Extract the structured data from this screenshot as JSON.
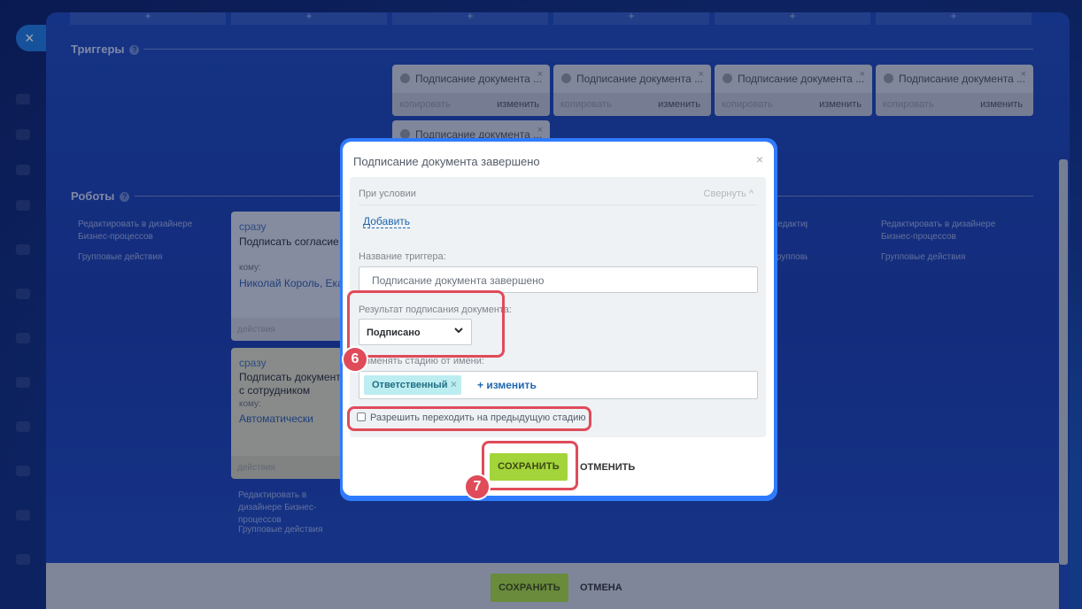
{
  "triggers_section": {
    "title": "Триггеры",
    "help": "?"
  },
  "robots_section": {
    "title": "Роботы",
    "help": "?"
  },
  "column_headers": [
    "+",
    "+",
    "+",
    "+",
    "+",
    "+"
  ],
  "trigger_cards": [
    {
      "name": "Подписание документа ...",
      "copy": "копировать",
      "edit": "изменить",
      "close": "×"
    },
    {
      "name": "Подписание документа ...",
      "copy": "копировать",
      "edit": "изменить",
      "close": "×"
    },
    {
      "name": "Подписание документа ...",
      "copy": "копировать",
      "edit": "изменить",
      "close": "×"
    },
    {
      "name": "Подписание документа ...",
      "copy": "копировать",
      "edit": "изменить",
      "close": "×"
    },
    {
      "name": "Подписание документа ...",
      "close": "×"
    }
  ],
  "side_links": {
    "edit_designer": "Редактировать в дизайнере Бизнес-процессов",
    "group_actions": "Групповые действия"
  },
  "robots": [
    {
      "when": "сразу",
      "title": "Подписать согласие на",
      "to_label": "кому:",
      "who": "Николай Король, Екат",
      "footer": "действия"
    },
    {
      "when": "сразу",
      "title": "Подписать документ с сотрудником",
      "to_label": "кому:",
      "who": "Автоматически",
      "footer": "действия"
    }
  ],
  "modal": {
    "title": "Подписание документа завершено",
    "close": "×",
    "condition_label": "При условии",
    "collapse_label": "Свернуть ^",
    "add_label": "Добавить",
    "trigger_name_label": "Название триггера:",
    "trigger_name_value": "Подписание документа завершено",
    "result_label": "Результат подписания документа:",
    "result_value": "Подписано",
    "change_stage_label": "Изменять стадию от имени:",
    "responsible_tag": "Ответственный",
    "tag_remove": "×",
    "change_link": "+ изменить",
    "allow_prev_stage_label": "Разрешить переходить на предыдущую стадию",
    "save_label": "СОХРАНИТЬ",
    "cancel_label": "ОТМЕНИТЬ"
  },
  "annotations": {
    "step6": "6",
    "step7": "7"
  },
  "bottom_bar": {
    "save_label": "СОХРАНИТЬ",
    "cancel_label": "ОТМЕНА"
  },
  "rail": {
    "close": "×"
  },
  "colors": {
    "accent_green": "#a3d43a",
    "highlight_red": "#e04b5a",
    "link_blue": "#2067b0",
    "tag_cyan": "#bcedf1"
  }
}
